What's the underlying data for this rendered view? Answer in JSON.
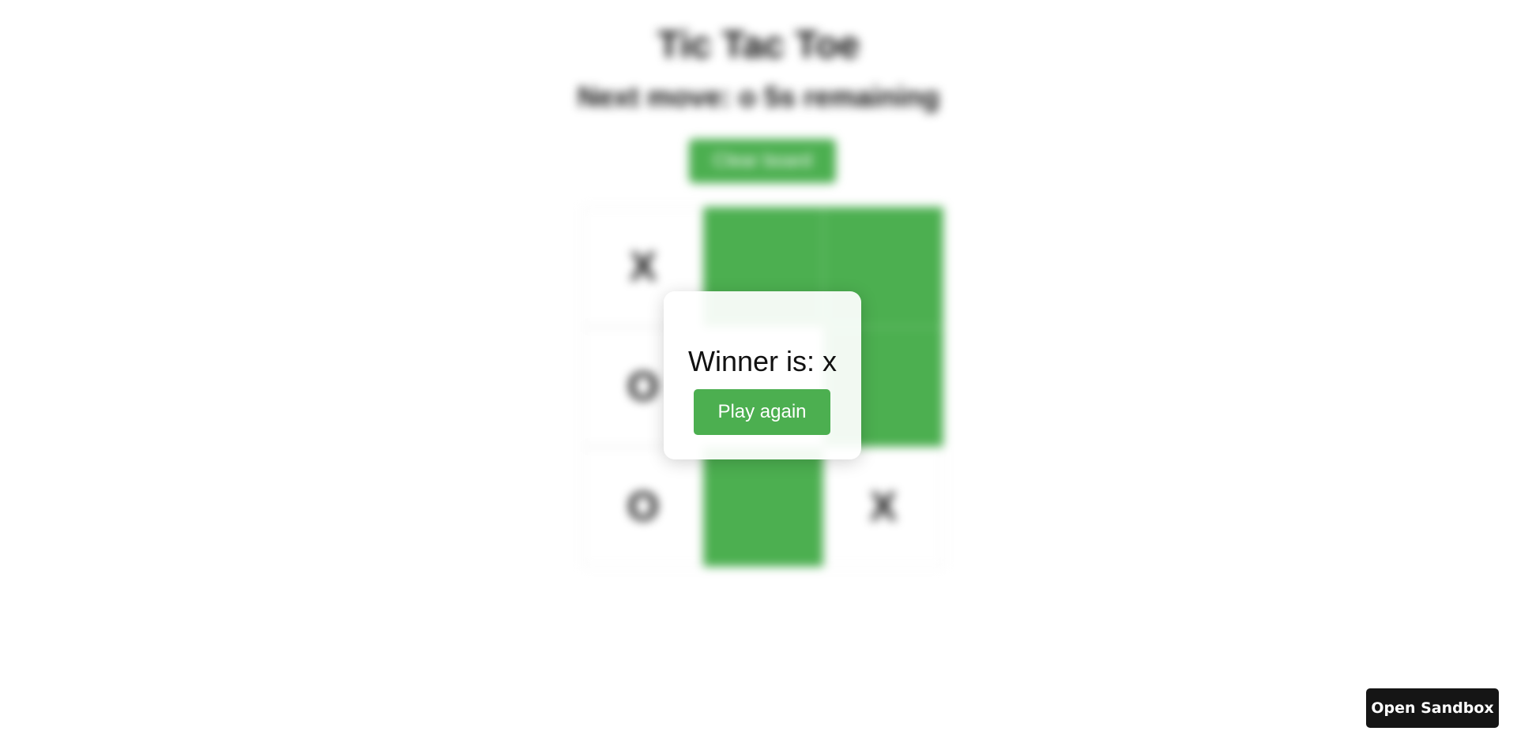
{
  "game": {
    "title": "Tic Tac Toe",
    "status": "Next move: o 5s remaining",
    "clear_label": "Clear board",
    "board": [
      {
        "value": "X",
        "win": false
      },
      {
        "value": "",
        "win": true
      },
      {
        "value": "",
        "win": true
      },
      {
        "value": "O",
        "win": false
      },
      {
        "value": "",
        "win": false
      },
      {
        "value": "",
        "win": true
      },
      {
        "value": "O",
        "win": false
      },
      {
        "value": "",
        "win": true
      },
      {
        "value": "X",
        "win": false
      }
    ]
  },
  "modal": {
    "title": "Winner is: x",
    "play_again_label": "Play again"
  },
  "sandbox": {
    "label": "Open Sandbox"
  },
  "colors": {
    "accent": "#4caf50",
    "dark_button": "#151515"
  }
}
